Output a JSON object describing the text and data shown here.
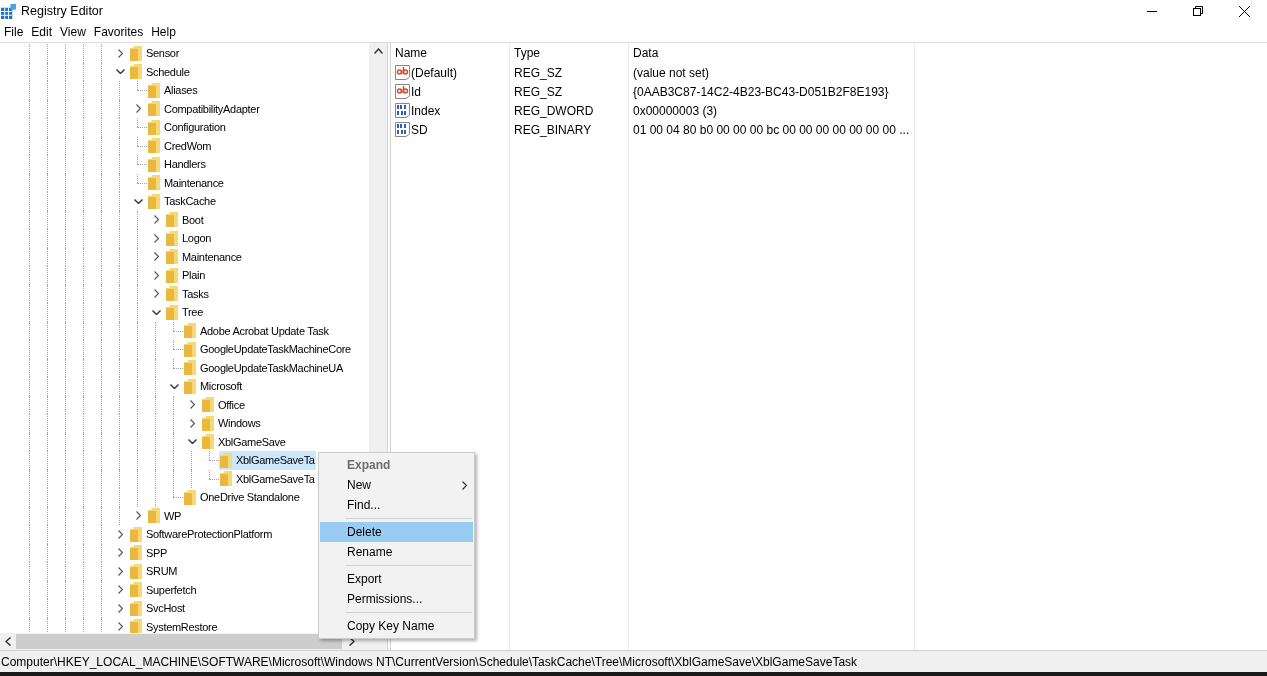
{
  "window": {
    "title": "Registry Editor"
  },
  "menu_bar": [
    "File",
    "Edit",
    "View",
    "Favorites",
    "Help"
  ],
  "tree": [
    {
      "label": "Sensor",
      "expanded": false,
      "selected": false
    },
    {
      "label": "Schedule",
      "expanded": true,
      "selected": false,
      "children": [
        {
          "label": "Aliases",
          "selected": false
        },
        {
          "label": "CompatibilityAdapter",
          "expanded": false,
          "selected": false
        },
        {
          "label": "Configuration",
          "selected": false
        },
        {
          "label": "CredWom",
          "selected": false
        },
        {
          "label": "Handlers",
          "selected": false
        },
        {
          "label": "Maintenance",
          "selected": false
        },
        {
          "label": "TaskCache",
          "expanded": true,
          "selected": false,
          "children": [
            {
              "label": "Boot",
              "expanded": false,
              "selected": false
            },
            {
              "label": "Logon",
              "expanded": false,
              "selected": false
            },
            {
              "label": "Maintenance",
              "expanded": false,
              "selected": false
            },
            {
              "label": "Plain",
              "expanded": false,
              "selected": false
            },
            {
              "label": "Tasks",
              "expanded": false,
              "selected": false
            },
            {
              "label": "Tree",
              "expanded": true,
              "selected": false,
              "children": [
                {
                  "label": "Adobe Acrobat Update Task",
                  "selected": false
                },
                {
                  "label": "GoogleUpdateTaskMachineCore",
                  "selected": false
                },
                {
                  "label": "GoogleUpdateTaskMachineUA",
                  "selected": false
                },
                {
                  "label": "Microsoft",
                  "expanded": true,
                  "selected": false,
                  "children": [
                    {
                      "label": "Office",
                      "expanded": false,
                      "selected": false
                    },
                    {
                      "label": "Windows",
                      "expanded": false,
                      "selected": false
                    },
                    {
                      "label": "XblGameSave",
                      "expanded": true,
                      "selected": false,
                      "children": [
                        {
                          "label": "XblGameSaveTa",
                          "selected": true
                        },
                        {
                          "label": "XblGameSaveTa",
                          "selected": false
                        }
                      ]
                    }
                  ]
                },
                {
                  "label": "OneDrive Standalone",
                  "selected": false
                }
              ]
            }
          ]
        },
        {
          "label": "WP",
          "expanded": false,
          "selected": false
        }
      ]
    },
    {
      "label": "SoftwareProtectionPlatform",
      "expanded": false,
      "selected": false
    },
    {
      "label": "SPP",
      "expanded": false,
      "selected": false
    },
    {
      "label": "SRUM",
      "expanded": false,
      "selected": false
    },
    {
      "label": "Superfetch",
      "expanded": false,
      "selected": false
    },
    {
      "label": "SvcHost",
      "expanded": false,
      "selected": false
    },
    {
      "label": "SystemRestore",
      "expanded": false,
      "selected": false
    }
  ],
  "values_table": {
    "columns": [
      "Name",
      "Type",
      "Data"
    ],
    "rows": [
      {
        "kind": "string",
        "name": "(Default)",
        "type": "REG_SZ",
        "data": "(value not set)"
      },
      {
        "kind": "string",
        "name": "Id",
        "type": "REG_SZ",
        "data": "{0AAB3C87-14C2-4B23-BC43-D051B2F8E193}"
      },
      {
        "kind": "binary",
        "name": "Index",
        "type": "REG_DWORD",
        "data": "0x00000003 (3)"
      },
      {
        "kind": "binary",
        "name": "SD",
        "type": "REG_BINARY",
        "data": "01 00 04 80 b0 00 00 00 bc 00 00 00 00 00 00 00 ..."
      }
    ]
  },
  "context_menu": [
    {
      "kind": "item",
      "label": "Expand",
      "default": true,
      "disabled": true,
      "submenu": false,
      "selected": false
    },
    {
      "kind": "item",
      "label": "New",
      "default": false,
      "disabled": false,
      "submenu": true,
      "selected": false
    },
    {
      "kind": "item",
      "label": "Find...",
      "default": false,
      "disabled": false,
      "submenu": false,
      "selected": false
    },
    {
      "kind": "separator"
    },
    {
      "kind": "item",
      "label": "Delete",
      "default": false,
      "disabled": false,
      "submenu": false,
      "selected": true
    },
    {
      "kind": "item",
      "label": "Rename",
      "default": false,
      "disabled": false,
      "submenu": false,
      "selected": false
    },
    {
      "kind": "separator"
    },
    {
      "kind": "item",
      "label": "Export",
      "default": false,
      "disabled": false,
      "submenu": false,
      "selected": false
    },
    {
      "kind": "item",
      "label": "Permissions...",
      "default": false,
      "disabled": false,
      "submenu": false,
      "selected": false
    },
    {
      "kind": "separator"
    },
    {
      "kind": "item",
      "label": "Copy Key Name",
      "default": false,
      "disabled": false,
      "submenu": false,
      "selected": false
    }
  ],
  "status_bar": "Computer\\HKEY_LOCAL_MACHINE\\SOFTWARE\\Microsoft\\Windows NT\\CurrentVersion\\Schedule\\TaskCache\\Tree\\Microsoft\\XblGameSave\\XblGameSaveTask"
}
